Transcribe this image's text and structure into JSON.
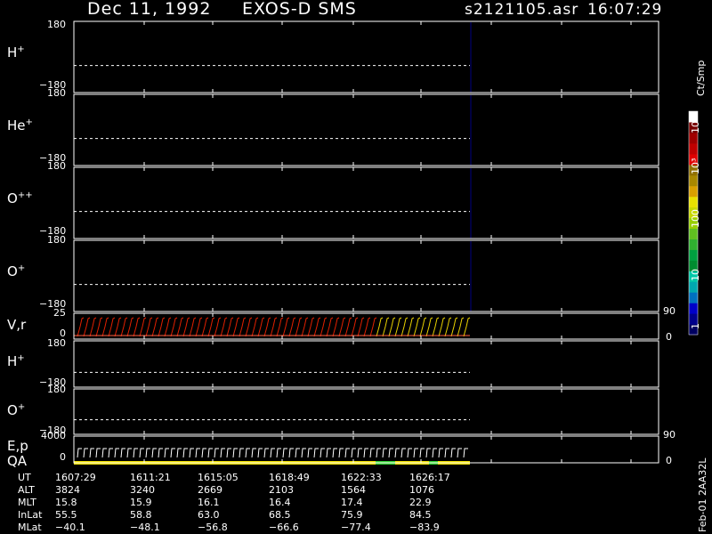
{
  "header": {
    "date": "Dec 11, 1992",
    "mission": "EXOS-D SMS",
    "file": "s2121105.asr",
    "time": "16:07:29"
  },
  "colors": {
    "background": "#000000",
    "frame": "#ffffff",
    "scale": [
      "#000060",
      "#00008c",
      "#0000c8",
      "#0070c0",
      "#00a8b0",
      "#00c8a8",
      "#008c30",
      "#00a040",
      "#30b030",
      "#60c020",
      "#98d000",
      "#c8d800",
      "#e8e000",
      "#d8a000",
      "#a88800",
      "#907000",
      "#e00000",
      "#c00000",
      "#a00000",
      "#780000",
      "#ffffff"
    ]
  },
  "panels": [
    {
      "label": "H",
      "sup": "+",
      "top_tick": "180",
      "bottom_tick": "−180"
    },
    {
      "label": "He",
      "sup": "+",
      "top_tick": "180",
      "bottom_tick": "−180"
    },
    {
      "label": "O",
      "sup": "++",
      "top_tick": "180",
      "bottom_tick": "−180"
    },
    {
      "label": "O",
      "sup": "+",
      "top_tick": "180",
      "bottom_tick": "−180"
    },
    {
      "label": "V,r",
      "sup": "",
      "top_tick": "25",
      "bottom_tick": "0",
      "right_top": "90",
      "right_bottom": "0"
    },
    {
      "label": "H",
      "sup": "+",
      "top_tick": "180",
      "bottom_tick": "−180"
    },
    {
      "label": "O",
      "sup": "+",
      "top_tick": "180",
      "bottom_tick": "−180"
    },
    {
      "label": "E,p",
      "sup": "",
      "label2": "QA",
      "top_tick": "4000",
      "bottom_tick": "0",
      "right_top": "90",
      "right_bottom": "0"
    }
  ],
  "colorbar": {
    "unit": "Ct/Smp",
    "labels": [
      "10⁴",
      "10³",
      "100",
      "10",
      "1"
    ]
  },
  "footer": {
    "rows": [
      {
        "name": "UT",
        "values": [
          "1607:29",
          "1611:21",
          "1615:05",
          "1618:49",
          "1622:33",
          "1626:17"
        ]
      },
      {
        "name": "ALT",
        "values": [
          "3824",
          "3240",
          "2669",
          "2103",
          "1564",
          "1076"
        ]
      },
      {
        "name": "MLT",
        "values": [
          "15.8",
          "15.9",
          "16.1",
          "16.4",
          "17.4",
          "22.9"
        ]
      },
      {
        "name": "InLat",
        "values": [
          "55.5",
          "58.8",
          "63.0",
          "68.5",
          "75.9",
          "84.5"
        ]
      },
      {
        "name": "MLat",
        "values": [
          "−40.1",
          "−48.1",
          "−56.8",
          "−66.6",
          "−77.4",
          "−83.9"
        ]
      }
    ]
  },
  "side_text": "Feb-01 2AA32L",
  "chart_data": {
    "type": "heatmap",
    "title": "Dec 11, 1992   EXOS-D SMS",
    "xlabel": "UT",
    "x_ticks": [
      "1607:29",
      "1611:21",
      "1615:05",
      "1618:49",
      "1622:33",
      "1626:17"
    ],
    "pitch_angle_range": [
      -180,
      180
    ],
    "vr_range": [
      0,
      25
    ],
    "energy_range": [
      0,
      4000
    ],
    "color_scale": "log",
    "color_range": [
      1,
      10000
    ],
    "color_unit": "Ct/Smp",
    "data_end_ut": "1629:30",
    "series": [
      {
        "name": "H+"
      },
      {
        "name": "He+"
      },
      {
        "name": "O++"
      },
      {
        "name": "O+"
      },
      {
        "name": "V,r"
      },
      {
        "name": "H+"
      },
      {
        "name": "O+"
      },
      {
        "name": "E,p"
      }
    ]
  }
}
